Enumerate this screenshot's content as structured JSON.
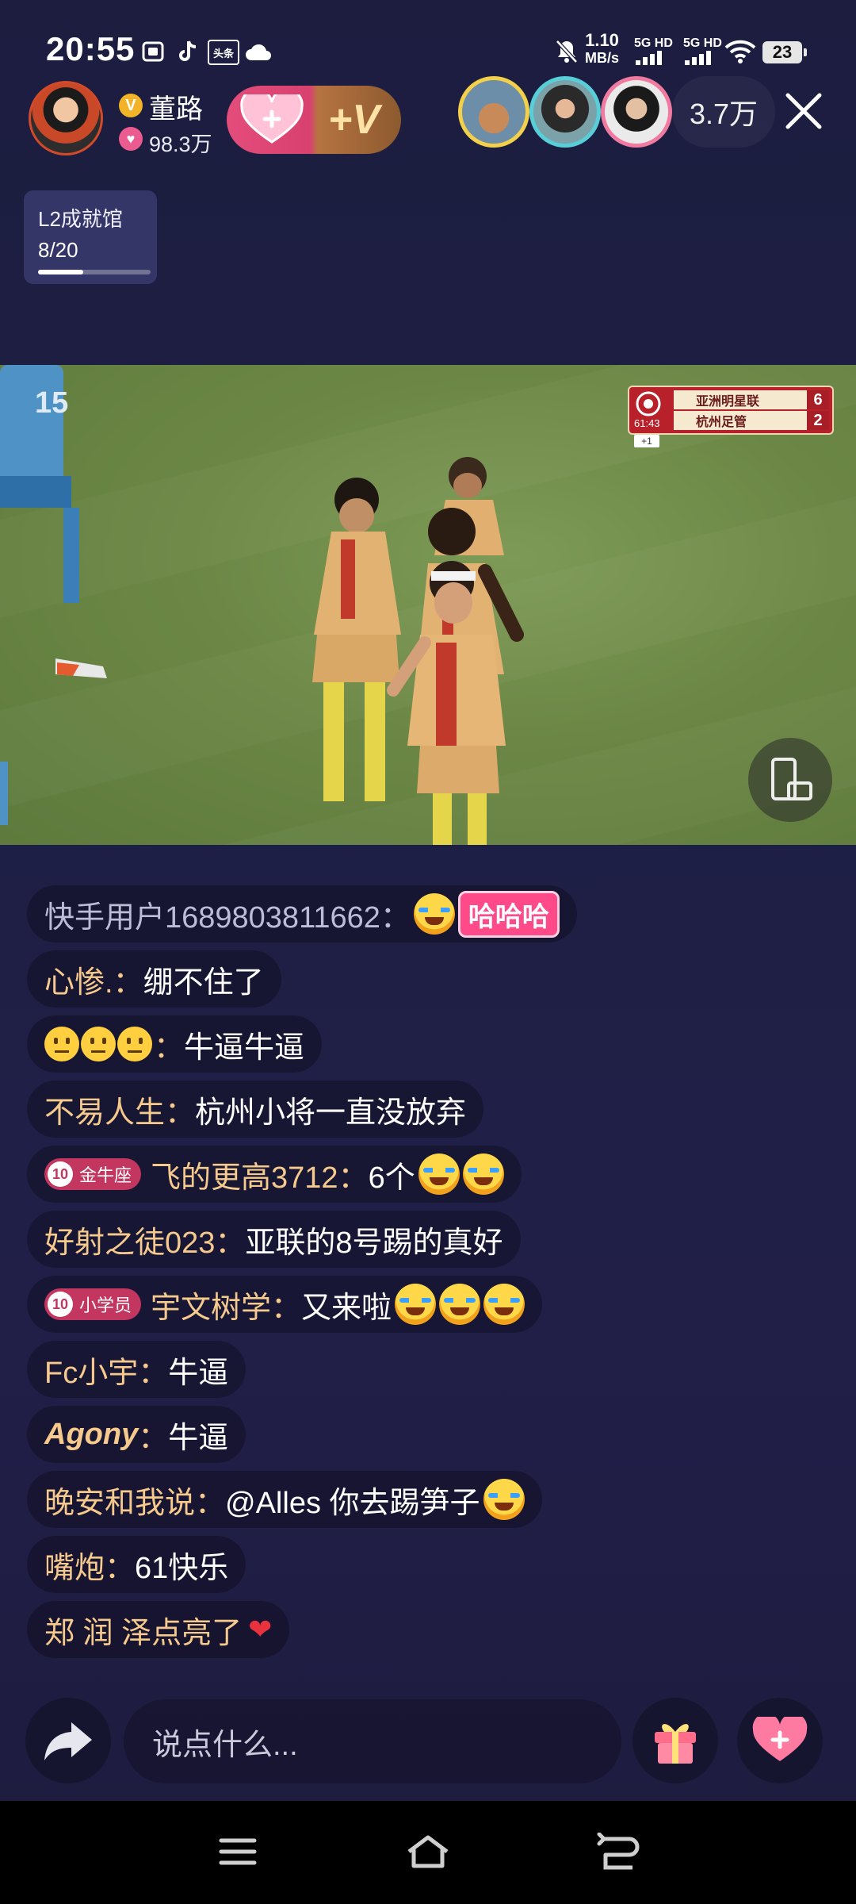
{
  "status_bar": {
    "time": "20:55",
    "net_speed": "1.10",
    "net_unit": "MB/s",
    "sim1": "5G HD",
    "sim2": "5G HD",
    "battery": "23",
    "app_icon_label": "头条"
  },
  "host": {
    "name": "董路",
    "vip_letter": "V",
    "likes": "98.3万"
  },
  "follow_button": {
    "plus_label": "+V"
  },
  "viewers": {
    "count": "3.7万",
    "close_label": "✕"
  },
  "achievement": {
    "title": "L2成就馆",
    "progress": "8/20",
    "fraction": 0.4
  },
  "scoreboard": {
    "time": "61:43",
    "teams": [
      {
        "name": "亚洲明星联",
        "score": "6"
      },
      {
        "name": "杭州足管",
        "score": "2"
      }
    ],
    "extra": "+1"
  },
  "chat": [
    {
      "user": "快手用户1689803811662：",
      "text": "",
      "haha": "哈哈哈"
    },
    {
      "user": "心惨.：",
      "text": "绷不住了"
    },
    {
      "user": "：",
      "text": "牛逼牛逼"
    },
    {
      "user": "不易人生：",
      "text": "杭州小将一直没放弃"
    },
    {
      "badge_level": "10",
      "badge": "金牛座",
      "user": "飞的更高3712：",
      "text": "6个"
    },
    {
      "user": "好射之徒023：",
      "text": "亚联的8号踢的真好"
    },
    {
      "badge_level": "10",
      "badge": "小学员",
      "user": "宇文树学：",
      "text": "又来啦"
    },
    {
      "user": "Fc小宇：",
      "text": "牛逼"
    },
    {
      "user": "Agony",
      "sep": "：",
      "text": "牛逼"
    },
    {
      "user": "晚安和我说：",
      "text": "@Alles 你去踢笋子"
    },
    {
      "user": "嘴炮：",
      "text": "61快乐"
    },
    {
      "user": "郑 润 泽点亮了",
      "text": ""
    }
  ],
  "input": {
    "placeholder": "说点什么..."
  },
  "colors": {
    "accent_pink": "#e44d7b",
    "username": "#f6c98c",
    "badge": "#c2365f"
  }
}
